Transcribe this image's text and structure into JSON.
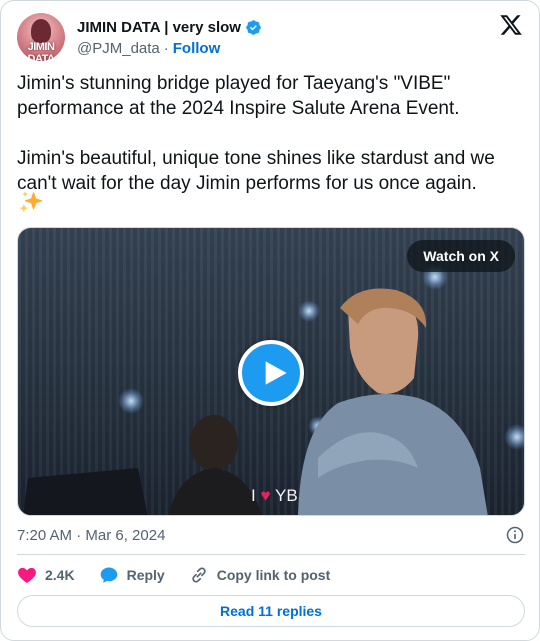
{
  "author": {
    "display_name": "JIMIN DATA | very slow",
    "handle": "@PJM_data",
    "separator": "·",
    "follow_label": "Follow",
    "avatar_text": "JIMIN DATA"
  },
  "tweet": {
    "text": "Jimin's stunning bridge played for Taeyang's \"VIBE\" performance at the 2024 Inspire Salute Arena Event.\n\nJimin's beautiful, unique tone shines like stardust and we can't wait for the day Jimin performs for us once again.",
    "emoji": "sparkles-emoji"
  },
  "media": {
    "watch_label": "Watch on X",
    "caption_prefix": "I",
    "caption_suffix": "YB",
    "caption_heart": "♥",
    "play_icon": "play-icon"
  },
  "meta": {
    "timestamp": "7:20 AM · Mar 6, 2024",
    "info_icon": "info-icon"
  },
  "actions": {
    "like_count": "2.4K",
    "reply_label": "Reply",
    "copy_label": "Copy link to post"
  },
  "footer": {
    "read_replies_label": "Read 11 replies"
  },
  "colors": {
    "accent": "#1d9bf0",
    "link": "#006fd6",
    "like": "#f91880",
    "muted": "#536471",
    "border": "#cfd9de"
  }
}
